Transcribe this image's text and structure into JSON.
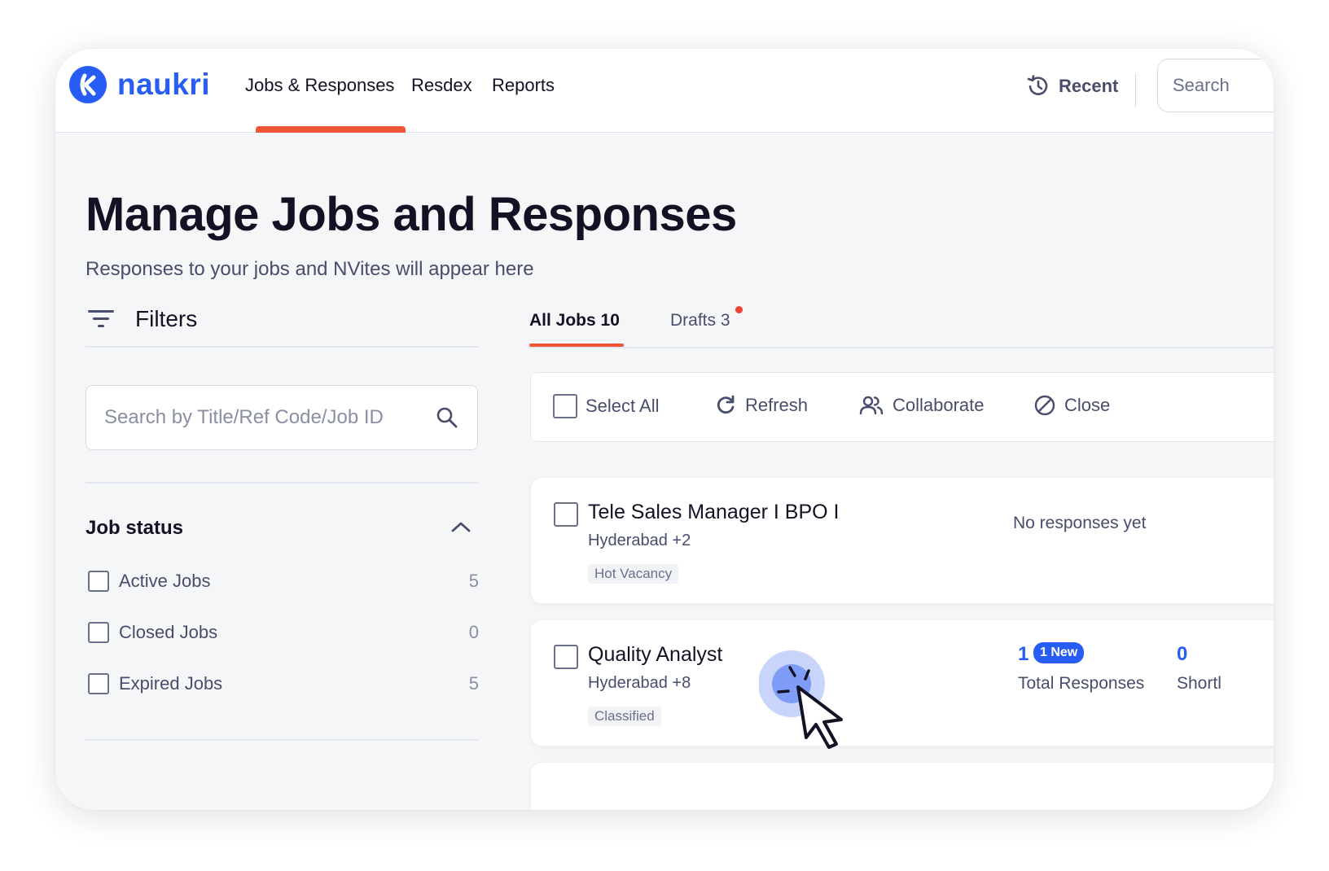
{
  "header": {
    "logo_text": "naukri",
    "nav": [
      "Jobs & Responses",
      "Resdex",
      "Reports"
    ],
    "recent_label": "Recent",
    "search_placeholder": "Search"
  },
  "page": {
    "title": "Manage Jobs and Responses",
    "subtitle": "Responses to your jobs and NVites will appear here"
  },
  "filters": {
    "title": "Filters",
    "search_placeholder": "Search by Title/Ref Code/Job ID",
    "job_status_label": "Job status",
    "options": [
      {
        "label": "Active Jobs",
        "count": "5"
      },
      {
        "label": "Closed Jobs",
        "count": "0"
      },
      {
        "label": "Expired Jobs",
        "count": "5"
      }
    ]
  },
  "tabs": [
    {
      "label": "All Jobs 10",
      "active": true
    },
    {
      "label": "Drafts 3",
      "active": false
    }
  ],
  "toolbar": {
    "select_all": "Select All",
    "refresh": "Refresh",
    "collaborate": "Collaborate",
    "close": "Close"
  },
  "jobs": [
    {
      "title": "Tele Sales Manager I BPO I",
      "location": "Hyderabad +2",
      "tag": "Hot Vacancy",
      "no_responses": "No responses yet"
    },
    {
      "title": "Quality Analyst",
      "location": "Hyderabad +8",
      "tag": "Classified",
      "total_count": "1",
      "new_badge": "1 New",
      "total_label": "Total Responses",
      "shortlisted_count": "0",
      "shortlisted_label": "Shortl"
    }
  ],
  "colors": {
    "brand_blue": "#275df5",
    "accent_red": "#f05537",
    "text_dark": "#121224",
    "text_muted": "#474d6a"
  }
}
